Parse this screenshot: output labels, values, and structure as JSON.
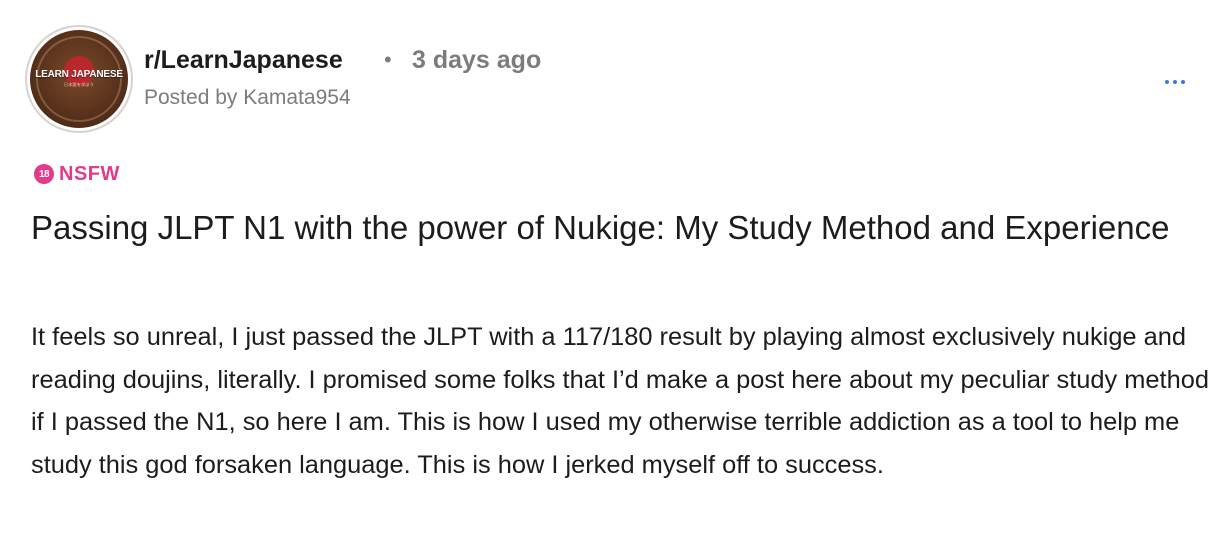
{
  "header": {
    "subreddit": "r/LearnJapanese",
    "separator": "•",
    "time_ago": "3 days ago",
    "posted_by": "Posted by Kamata954",
    "avatar_logo_text": "LEARN JAPANESE",
    "avatar_logo_sub": "日本語を学ぼう",
    "more_icon": "ellipsis-icon"
  },
  "tag": {
    "icon_text": "18",
    "label": "NSFW",
    "color": "#e33a8a"
  },
  "post": {
    "title": "Passing JLPT N1 with the power of Nukige: My Study Method and Experience",
    "body": "It feels so unreal, I just passed the JLPT with a 117/180 result by playing almost exclusively nukige and reading doujins, literally. I promised some folks that I’d make a post here about my peculiar study method if I passed the N1, so here I am. This is how I used my otherwise terrible addiction as a tool to help me study this god forsaken language. This is how I jerked myself off to success."
  },
  "colors": {
    "accent": "#3a7bd5",
    "meta": "#7c7c7c",
    "text": "#1c1c1c"
  }
}
